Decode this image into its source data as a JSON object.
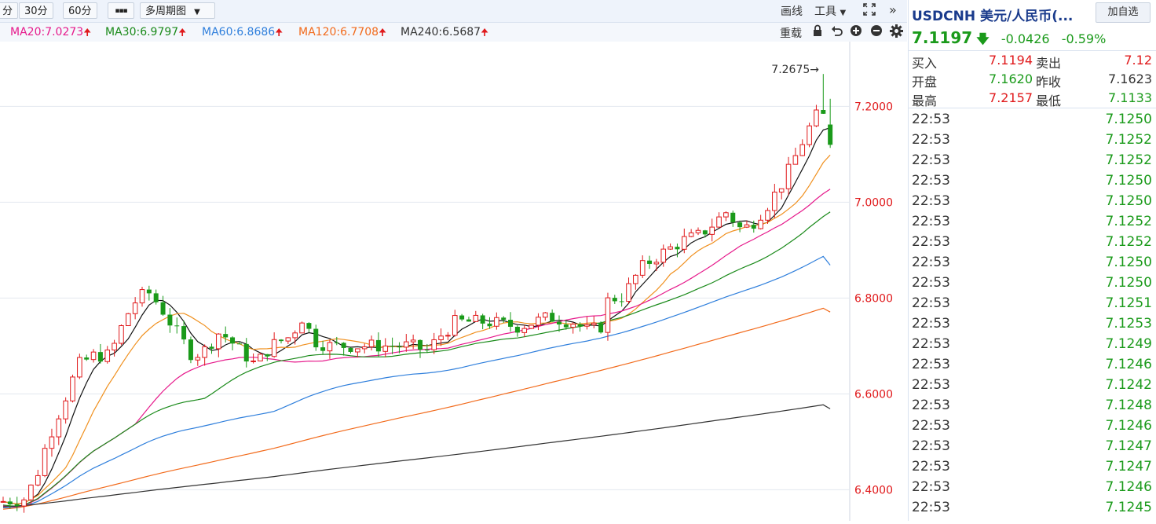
{
  "toolbar": {
    "tf_partial": "分",
    "tf_30": "30分",
    "tf_60": "60分",
    "more": "▪▪▪",
    "multi_period": "多周期图",
    "draw": "画线",
    "tools": "工具"
  },
  "ma_bar": {
    "items": [
      {
        "label": "MA20:7.0273",
        "color": "#e6198b"
      },
      {
        "label": "MA30:6.9797",
        "color": "#1a8a1a"
      },
      {
        "label": "MA60:6.8686",
        "color": "#2f7fdc"
      },
      {
        "label": "MA120:6.7708",
        "color": "#f26a1b"
      },
      {
        "label": "MA240:6.5687",
        "color": "#333333"
      }
    ],
    "arrow": "🠉",
    "reset": "重载"
  },
  "chart_data": {
    "type": "candlestick",
    "price_axis_ticks": [
      "7.2000",
      "7.0000",
      "6.8000",
      "6.6000",
      "6.4000"
    ],
    "max_annotation": "7.2675→",
    "ylim": [
      6.335,
      7.335
    ],
    "last_close": 7.1197
  },
  "quote": {
    "symbol": "USDCNH 美元/人民币(...",
    "add_watch": "加自选",
    "price": "7.1197",
    "change": "-0.0426",
    "change_pct": "-0.59%",
    "bid_label": "买入",
    "bid": "7.1194",
    "ask_label": "卖出",
    "ask": "7.12",
    "open_label": "开盘",
    "open": "7.1620",
    "prev_label": "昨收",
    "prev": "7.1623",
    "high_label": "最高",
    "high": "7.2157",
    "low_label": "最低",
    "low": "7.1133"
  },
  "ticks": [
    {
      "time": "22:53",
      "price": "7.1250"
    },
    {
      "time": "22:53",
      "price": "7.1252"
    },
    {
      "time": "22:53",
      "price": "7.1252"
    },
    {
      "time": "22:53",
      "price": "7.1250"
    },
    {
      "time": "22:53",
      "price": "7.1250"
    },
    {
      "time": "22:53",
      "price": "7.1252"
    },
    {
      "time": "22:53",
      "price": "7.1252"
    },
    {
      "time": "22:53",
      "price": "7.1250"
    },
    {
      "time": "22:53",
      "price": "7.1250"
    },
    {
      "time": "22:53",
      "price": "7.1251"
    },
    {
      "time": "22:53",
      "price": "7.1253"
    },
    {
      "time": "22:53",
      "price": "7.1249"
    },
    {
      "time": "22:53",
      "price": "7.1246"
    },
    {
      "time": "22:53",
      "price": "7.1242"
    },
    {
      "time": "22:53",
      "price": "7.1248"
    },
    {
      "time": "22:53",
      "price": "7.1246"
    },
    {
      "time": "22:53",
      "price": "7.1247"
    },
    {
      "time": "22:53",
      "price": "7.1247"
    },
    {
      "time": "22:53",
      "price": "7.1246"
    },
    {
      "time": "22:53",
      "price": "7.1245"
    }
  ],
  "colors": {
    "up": "#e0191b",
    "down": "#1a9a1a",
    "axis_text": "#e0191b"
  }
}
